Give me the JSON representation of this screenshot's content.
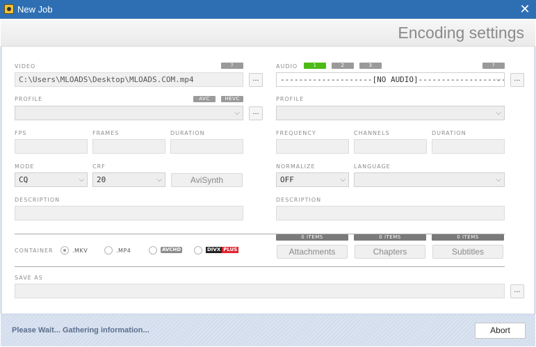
{
  "window": {
    "title": "New Job",
    "close_glyph": "✕"
  },
  "header": {
    "title": "Encoding settings"
  },
  "video": {
    "label": "VIDEO",
    "help": "?",
    "path": "C:\\Users\\MLOADS\\Desktop\\MLOADS.COM.mp4",
    "browse": "...",
    "profile_label": "PROFILE",
    "avc": "AVC",
    "hevc": "HEVC",
    "profile_value": "",
    "profile_browse": "...",
    "fps_label": "FPS",
    "frames_label": "FRAMES",
    "duration_label": "DURATION",
    "mode_label": "MODE",
    "mode_value": "CQ",
    "crf_label": "CRF",
    "crf_value": "20",
    "avisynth": "AviSynth",
    "description_label": "DESCRIPTION"
  },
  "audio": {
    "label": "AUDIO",
    "tracks": [
      "1",
      "2",
      "3"
    ],
    "help": "?",
    "track_value": "--------------------[NO AUDIO]--------------------",
    "browse": "...",
    "profile_label": "PROFILE",
    "frequency_label": "FREQUENCY",
    "channels_label": "CHANNELS",
    "duration_label": "DURATION",
    "normalize_label": "NORMALIZE",
    "normalize_value": "OFF",
    "language_label": "LANGUAGE",
    "description_label": "DESCRIPTION"
  },
  "container": {
    "label": "CONTAINER",
    "options": {
      "mkv": ".MKV",
      "mp4": ".MP4",
      "avchd": "AVCHD",
      "divx_a": "DIVX",
      "divx_b": "PLUS"
    },
    "selected": "mkv"
  },
  "attachments": {
    "count": "0 ITEMS",
    "label": "Attachments"
  },
  "chapters": {
    "count": "0 ITEMS",
    "label": "Chapters"
  },
  "subtitles": {
    "count": "0 ITEMS",
    "label": "Subtitles"
  },
  "save_as": {
    "label": "SAVE AS",
    "value": "",
    "browse": "..."
  },
  "footer": {
    "status": "Please Wait... Gathering information...",
    "abort": "Abort"
  }
}
